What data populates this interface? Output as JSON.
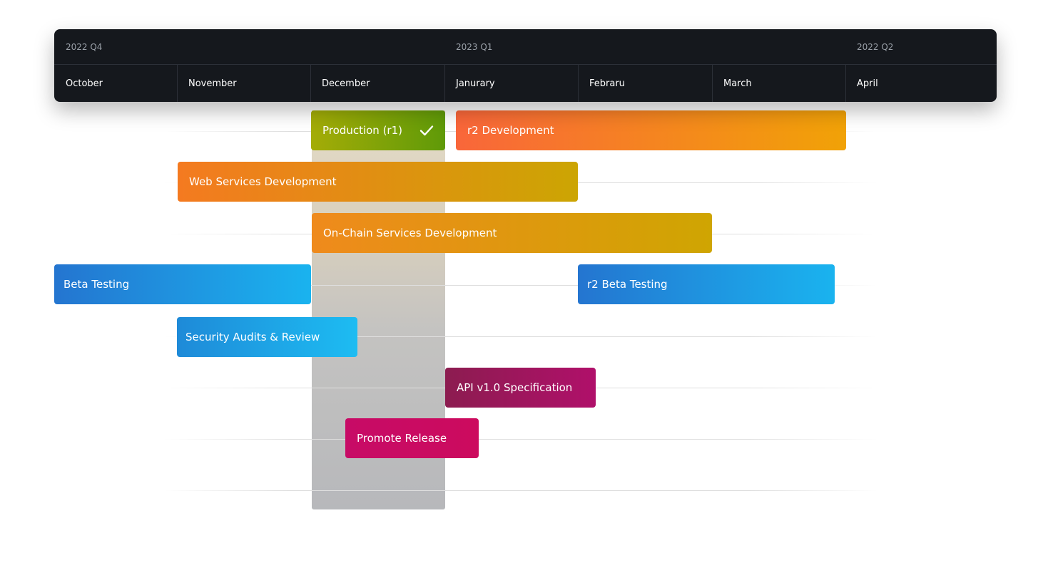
{
  "header": {
    "quarters": [
      {
        "label": "2022 Q4"
      },
      {
        "label": "2023 Q1"
      },
      {
        "label": "2022 Q2"
      }
    ],
    "months": [
      {
        "label": "October"
      },
      {
        "label": "November"
      },
      {
        "label": "December"
      },
      {
        "label": "Janurary"
      },
      {
        "label": "Febraru"
      },
      {
        "label": "March"
      },
      {
        "label": "April"
      }
    ]
  },
  "tasks": [
    {
      "label": "Production (r1)",
      "status": "completed",
      "colors": [
        "#a4ac07",
        "#5f9a08"
      ]
    },
    {
      "label": "r2 Development",
      "colors": [
        "#f9663a",
        "#f1a207"
      ]
    },
    {
      "label": "Web Services Development",
      "colors": [
        "#f47a20",
        "#cca503"
      ]
    },
    {
      "label": "On-Chain Services Development",
      "colors": [
        "#ef8a1c",
        "#cfa502"
      ]
    },
    {
      "label": "Beta Testing",
      "colors": [
        "#2475d0",
        "#1ab3ef"
      ]
    },
    {
      "label": "r2 Beta Testing",
      "colors": [
        "#2475d0",
        "#1ab3ef"
      ]
    },
    {
      "label": "Security Audits & Review",
      "colors": [
        "#1e8ad8",
        "#1dbcf2"
      ]
    },
    {
      "label": "API v1.0 Specification",
      "colors": [
        "#8c1c50",
        "#b0106a"
      ]
    },
    {
      "label": "Promote Release",
      "colors": [
        "#c70b66",
        "#cc0b5e"
      ]
    }
  ]
}
